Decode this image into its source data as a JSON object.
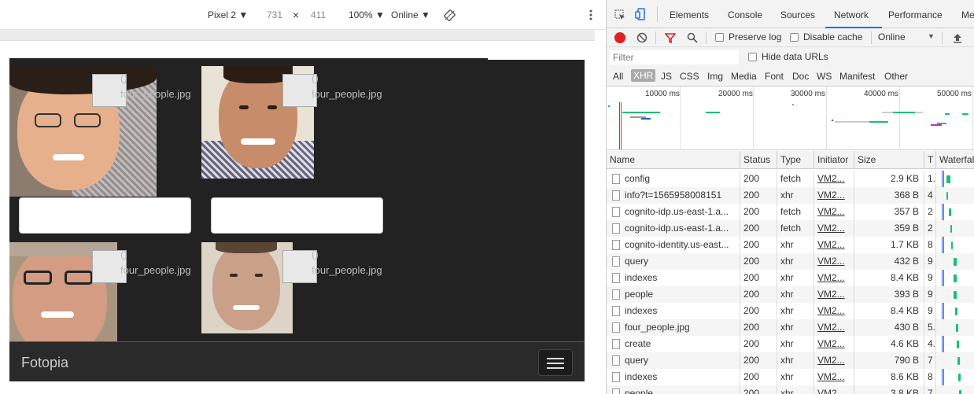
{
  "device_toolbar": {
    "device": "Pixel 2 ▼",
    "width": "731",
    "times": "×",
    "height": "411",
    "zoom": "100% ▼",
    "network": "Online ▼"
  },
  "app": {
    "brand": "Fotopia",
    "faces": [
      {
        "tag": "()",
        "file": "four_people.jpg"
      },
      {
        "tag": "()",
        "file": "four_people.jpg"
      },
      {
        "tag": "()",
        "file": "four_people.jpg"
      },
      {
        "tag": "()",
        "file": "four_people.jpg"
      }
    ]
  },
  "devtools": {
    "tabs": [
      "Elements",
      "Console",
      "Sources",
      "Network",
      "Performance",
      "Me"
    ],
    "active_tab": "Network",
    "toolbar": {
      "preserve_log": "Preserve log",
      "disable_cache": "Disable cache",
      "throttle": "Online"
    },
    "filter": {
      "placeholder": "Filter",
      "hide_data_urls": "Hide data URLs",
      "types": [
        "All",
        "XHR",
        "JS",
        "CSS",
        "Img",
        "Media",
        "Font",
        "Doc",
        "WS",
        "Manifest",
        "Other"
      ],
      "active_type": "XHR"
    },
    "overview": {
      "ticks": [
        "10000 ms",
        "20000 ms",
        "30000 ms",
        "40000 ms",
        "50000 ms"
      ]
    },
    "columns": [
      "Name",
      "Status",
      "Type",
      "Initiator",
      "Size",
      "T",
      "Waterfall"
    ],
    "rows": [
      {
        "name": "config",
        "status": "200",
        "type": "fetch",
        "initiator": "VM2...",
        "size": "2.9 KB",
        "time": "1."
      },
      {
        "name": "info?t=1565958008151",
        "status": "200",
        "type": "xhr",
        "initiator": "VM2...",
        "size": "368 B",
        "time": "4"
      },
      {
        "name": "cognito-idp.us-east-1.a...",
        "status": "200",
        "type": "fetch",
        "initiator": "VM2...",
        "size": "357 B",
        "time": "2"
      },
      {
        "name": "cognito-idp.us-east-1.a...",
        "status": "200",
        "type": "fetch",
        "initiator": "VM2...",
        "size": "359 B",
        "time": "2"
      },
      {
        "name": "cognito-identity.us-east...",
        "status": "200",
        "type": "xhr",
        "initiator": "VM2...",
        "size": "1.7 KB",
        "time": "8"
      },
      {
        "name": "query",
        "status": "200",
        "type": "xhr",
        "initiator": "VM2...",
        "size": "432 B",
        "time": "9"
      },
      {
        "name": "indexes",
        "status": "200",
        "type": "xhr",
        "initiator": "VM2...",
        "size": "8.4 KB",
        "time": "9"
      },
      {
        "name": "people",
        "status": "200",
        "type": "xhr",
        "initiator": "VM2...",
        "size": "393 B",
        "time": "9"
      },
      {
        "name": "indexes",
        "status": "200",
        "type": "xhr",
        "initiator": "VM2...",
        "size": "8.4 KB",
        "time": "9"
      },
      {
        "name": "four_people.jpg",
        "status": "200",
        "type": "xhr",
        "initiator": "VM2...",
        "size": "430 B",
        "time": "5."
      },
      {
        "name": "create",
        "status": "200",
        "type": "xhr",
        "initiator": "VM2...",
        "size": "4.6 KB",
        "time": "4."
      },
      {
        "name": "query",
        "status": "200",
        "type": "xhr",
        "initiator": "VM2...",
        "size": "790 B",
        "time": "7"
      },
      {
        "name": "indexes",
        "status": "200",
        "type": "xhr",
        "initiator": "VM2...",
        "size": "8.6 KB",
        "time": "8"
      },
      {
        "name": "people",
        "status": "200",
        "type": "xhr",
        "initiator": "VM2...",
        "size": "3.8 KB",
        "time": "7"
      }
    ]
  }
}
